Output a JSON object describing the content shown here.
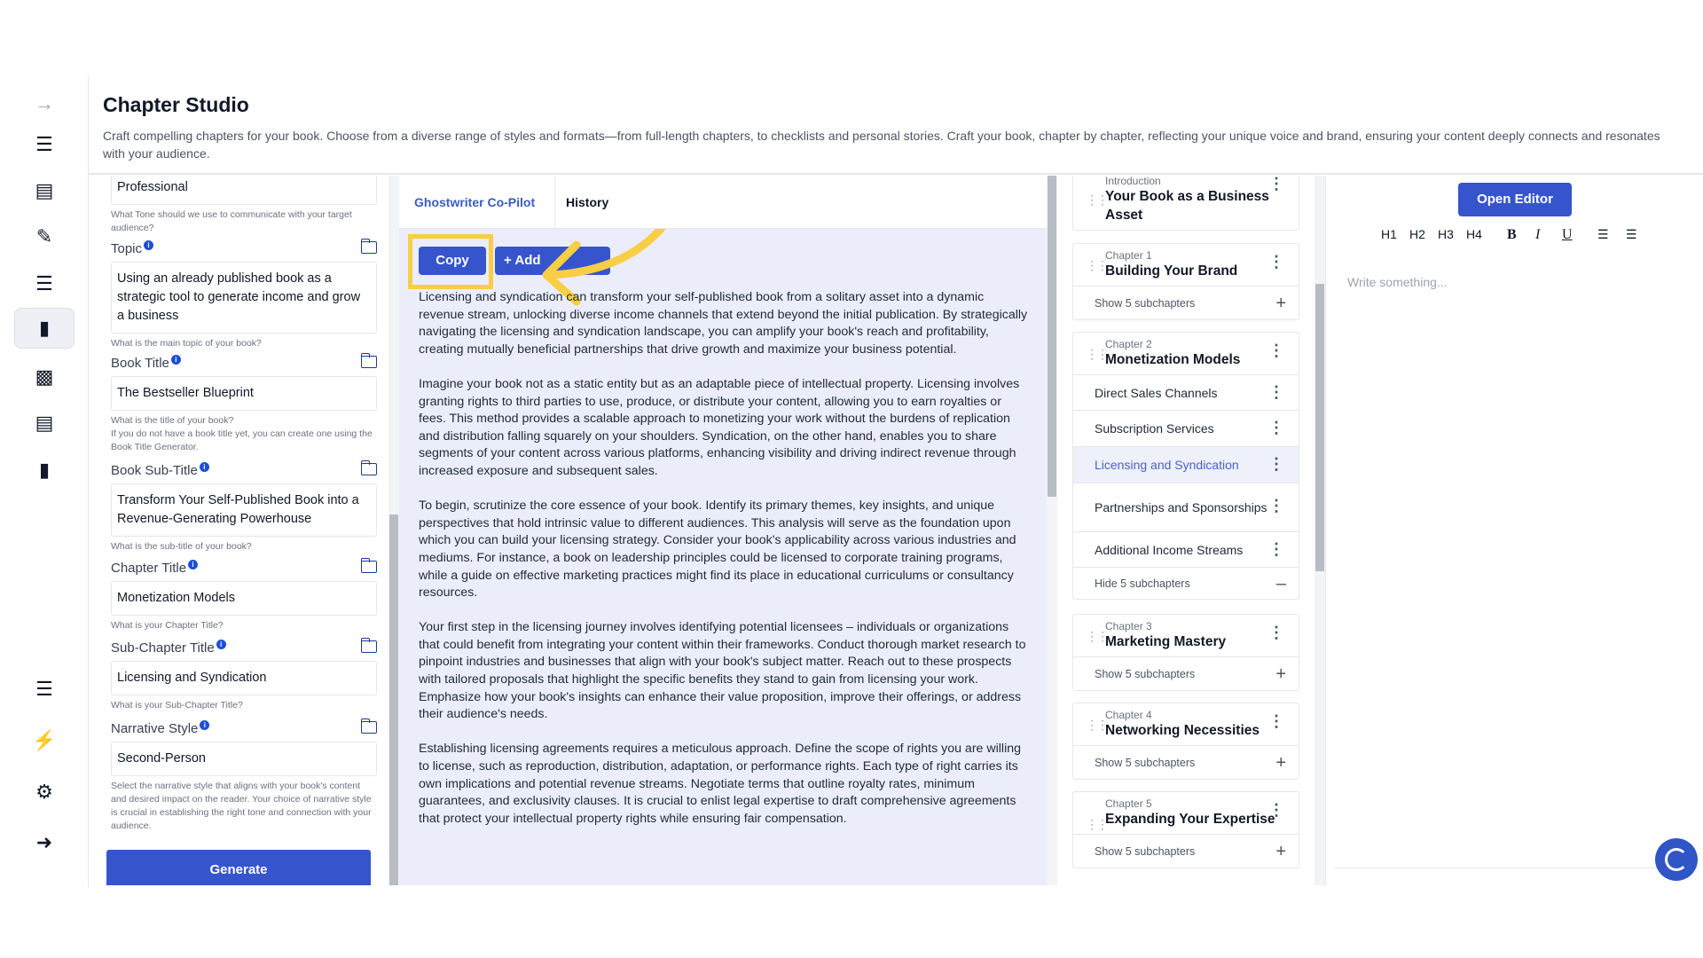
{
  "header": {
    "title": "Chapter Studio",
    "description": "Craft compelling chapters for your book. Choose from a diverse range of styles and formats—from full-length chapters, to checklists and personal stories. Craft your book, chapter by chapter, reflecting your unique voice and brand, ensuring your content deeply connects and resonates with your audience."
  },
  "form": {
    "tone": {
      "value": "Professional",
      "help": "What Tone should we use to communicate with your target audience?"
    },
    "topic": {
      "label": "Topic",
      "value": "Using an already published book as a strategic tool to generate income and grow a business",
      "help": "What is the main topic of your book?"
    },
    "book_title": {
      "label": "Book Title",
      "value": "The Bestseller Blueprint",
      "help": "What is the title of your book?",
      "help2": "If you do not have a book title yet, you can create one using the Book Title Generator."
    },
    "book_subtitle": {
      "label": "Book Sub-Title",
      "value": "Transform Your Self-Published Book into a Revenue-Generating Powerhouse",
      "help": "What is the sub-title of your book?"
    },
    "chapter_title": {
      "label": "Chapter Title",
      "value": "Monetization Models",
      "help": "What is your Chapter Title?"
    },
    "subchapter_title": {
      "label": "Sub-Chapter Title",
      "value": "Licensing and Syndication",
      "help": "What is your Sub-Chapter Title?"
    },
    "narrative_style": {
      "label": "Narrative Style",
      "value": "Second-Person",
      "help": "Select the narrative style that aligns with your book's content and desired impact on the reader. Your choice of narrative style is crucial in establishing the right tone and connection with your audience."
    },
    "generate_label": "Generate",
    "info_glyph": "i"
  },
  "tabs": {
    "copilot": "Ghostwriter Co-Pilot",
    "history": "History"
  },
  "actions": {
    "copy": "Copy",
    "add": "+ Add"
  },
  "content": {
    "paragraphs": [
      "Licensing and syndication can transform your self-published book from a solitary asset into a dynamic revenue stream, unlocking diverse income channels that extend beyond the initial publication. By strategically navigating the licensing and syndication landscape, you can amplify your book's reach and profitability, creating mutually beneficial partnerships that drive growth and maximize your business potential.",
      "Imagine your book not as a static entity but as an adaptable piece of intellectual property. Licensing involves granting rights to third parties to use, produce, or distribute your content, allowing you to earn royalties or fees. This method provides a scalable approach to monetizing your work without the burdens of replication and distribution falling squarely on your shoulders. Syndication, on the other hand, enables you to share segments of your content across various platforms, enhancing visibility and driving indirect revenue through increased exposure and subsequent sales.",
      "To begin, scrutinize the core essence of your book. Identify its primary themes, key insights, and unique perspectives that hold intrinsic value to different audiences. This analysis will serve as the foundation upon which you can build your licensing strategy. Consider your book's applicability across various industries and mediums. For instance, a book on leadership principles could be licensed to corporate training programs, while a guide on effective marketing practices might find its place in educational curriculums or consultancy resources.",
      "Your first step in the licensing journey involves identifying potential licensees – individuals or organizations that could benefit from integrating your content within their frameworks. Conduct thorough market research to pinpoint industries and businesses that align with your book's subject matter. Reach out to these prospects with tailored proposals that highlight the specific benefits they stand to gain from licensing your work. Emphasize how your book's insights can enhance their value proposition, improve their offerings, or address their audience's needs.",
      "Establishing licensing agreements requires a meticulous approach. Define the scope of rights you are willing to license, such as reproduction, distribution, adaptation, or performance rights. Each type of right carries its own implications and potential revenue streams. Negotiate terms that outline royalty rates, minimum guarantees, and exclusivity clauses. It is crucial to enlist legal expertise to draft comprehensive agreements that protect your intellectual property rights while ensuring fair compensation."
    ]
  },
  "outline": {
    "intro": {
      "small": "Introduction",
      "title": "Your Book as a Business Asset"
    },
    "ch1": {
      "small": "Chapter 1",
      "title": "Building Your Brand",
      "toggle": "Show 5 subchapters"
    },
    "ch2": {
      "small": "Chapter 2",
      "title": "Monetization Models",
      "toggle": "Hide 5 subchapters",
      "subs": [
        "Direct Sales Channels",
        "Subscription Services",
        "Licensing and Syndication",
        "Partnerships and Sponsorships",
        "Additional Income Streams"
      ]
    },
    "ch3": {
      "small": "Chapter 3",
      "title": "Marketing Mastery",
      "toggle": "Show 5 subchapters"
    },
    "ch4": {
      "small": "Chapter 4",
      "title": "Networking Necessities",
      "toggle": "Show 5 subchapters"
    },
    "ch5": {
      "small": "Chapter 5",
      "title": "Expanding Your Expertise",
      "toggle": "Show 5 subchapters"
    }
  },
  "editor": {
    "open_label": "Open Editor",
    "toolbar": {
      "h1": "H1",
      "h2": "H2",
      "h3": "H3",
      "h4": "H4",
      "bold": "B",
      "italic": "I",
      "underline": "U"
    },
    "placeholder": "Write something..."
  },
  "colors": {
    "accent": "#3655cc",
    "highlight": "#f8ce44",
    "content_bg": "#ecedfb"
  }
}
